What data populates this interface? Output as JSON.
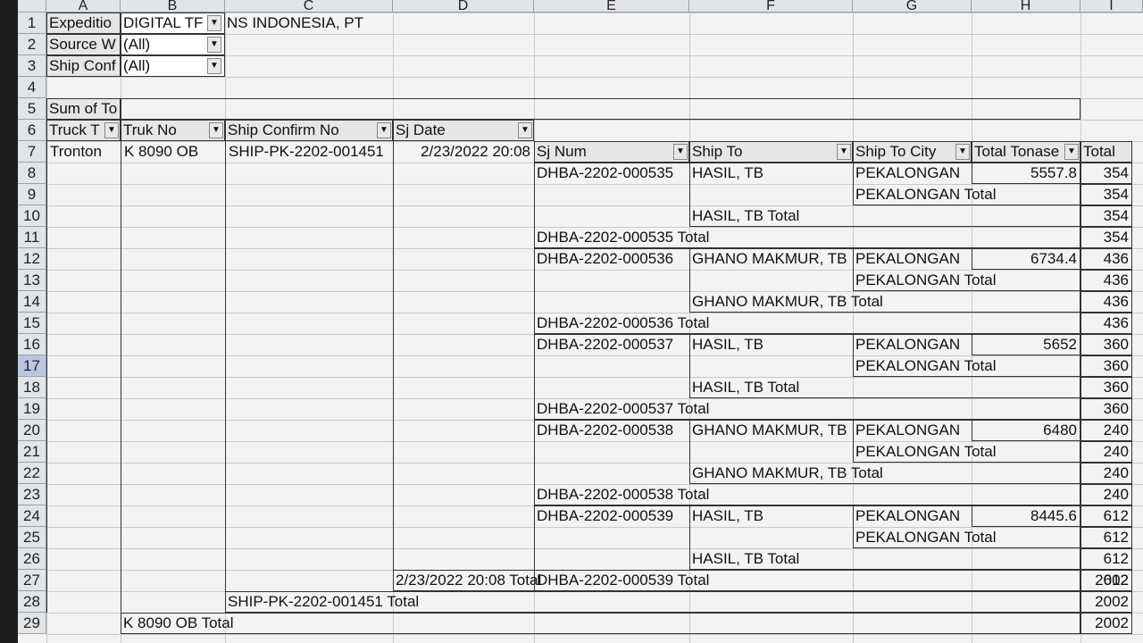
{
  "columns": [
    "A",
    "B",
    "C",
    "D",
    "E",
    "F",
    "G",
    "H",
    "I"
  ],
  "rows": [
    "1",
    "2",
    "3",
    "4",
    "5",
    "6",
    "7",
    "8",
    "9",
    "10",
    "11",
    "12",
    "13",
    "14",
    "15",
    "16",
    "17",
    "18",
    "19",
    "20",
    "21",
    "22",
    "23",
    "24",
    "25",
    "26",
    "27",
    "28",
    "29"
  ],
  "filters": [
    {
      "label": "Expeditio",
      "value": "DIGITAL TF",
      "rest": "NS INDONESIA, PT"
    },
    {
      "label": "Source W",
      "value": "(All)"
    },
    {
      "label": "Ship Conf",
      "value": "(All)"
    }
  ],
  "sum_label": "Sum of To",
  "headers": {
    "truck_type": "Truck T",
    "truk_no": "Truk No",
    "ship_confirm": "Ship Confirm No",
    "sj_date": "Sj Date",
    "sj_num": "Sj Num",
    "ship_to": "Ship To",
    "ship_to_city": "Ship To City",
    "total_tonase": "Total Tonase",
    "total": "Total"
  },
  "base": {
    "truck_type": "Tronton",
    "truk_no": "K 8090 OB",
    "ship_confirm": "SHIP-PK-2202-001451",
    "sj_date": "2/23/2022 20:08"
  },
  "groups": [
    {
      "sj_num": "DHBA-2202-000535",
      "ship_to": "HASIL, TB",
      "city": "PEKALONGAN",
      "tonase": "5557.8",
      "total": "354",
      "city_total_label": "PEKALONGAN Total",
      "city_total": "354",
      "shipto_total_label": "HASIL, TB Total",
      "shipto_total": "354",
      "sj_total_label": "DHBA-2202-000535 Total",
      "sj_total": "354"
    },
    {
      "sj_num": "DHBA-2202-000536",
      "ship_to": "GHANO MAKMUR, TB",
      "city": "PEKALONGAN",
      "tonase": "6734.4",
      "total": "436",
      "city_total_label": "PEKALONGAN Total",
      "city_total": "436",
      "shipto_total_label": "GHANO MAKMUR, TB Total",
      "shipto_total": "436",
      "sj_total_label": "DHBA-2202-000536 Total",
      "sj_total": "436"
    },
    {
      "sj_num": "DHBA-2202-000537",
      "ship_to": "HASIL, TB",
      "city": "PEKALONGAN",
      "tonase": "5652",
      "total": "360",
      "city_total_label": "PEKALONGAN Total",
      "city_total": "360",
      "shipto_total_label": "HASIL, TB Total",
      "shipto_total": "360",
      "sj_total_label": "DHBA-2202-000537 Total",
      "sj_total": "360"
    },
    {
      "sj_num": "DHBA-2202-000538",
      "ship_to": "GHANO MAKMUR, TB",
      "city": "PEKALONGAN",
      "tonase": "6480",
      "total": "240",
      "city_total_label": "PEKALONGAN Total",
      "city_total": "240",
      "shipto_total_label": "GHANO MAKMUR, TB Total",
      "shipto_total": "240",
      "sj_total_label": "DHBA-2202-000538 Total",
      "sj_total": "240"
    },
    {
      "sj_num": "DHBA-2202-000539",
      "ship_to": "HASIL, TB",
      "city": "PEKALONGAN",
      "tonase": "8445.6",
      "total": "612",
      "city_total_label": "PEKALONGAN Total",
      "city_total": "612",
      "shipto_total_label": "HASIL, TB Total",
      "shipto_total": "612",
      "sj_total_label": "DHBA-2202-000539 Total",
      "sj_total": "612"
    }
  ],
  "date_total": {
    "label": "2/23/2022 20:08 Total",
    "value": "2002"
  },
  "confirm_total": {
    "label": "SHIP-PK-2202-001451 Total",
    "value": "2002"
  },
  "truk_total": {
    "label": "K 8090 OB Total",
    "value": "2002"
  }
}
